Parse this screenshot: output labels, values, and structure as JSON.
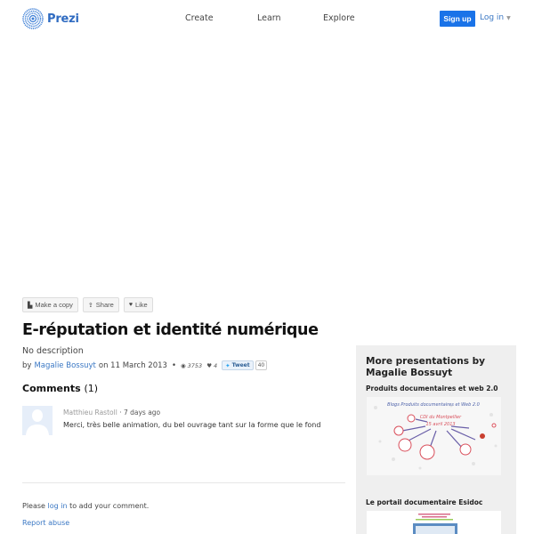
{
  "header": {
    "logo_text": "Prezi",
    "logo_icon": "prezi-logo-icon",
    "nav": [
      "Create",
      "Learn",
      "Explore"
    ],
    "signup_label": "Sign up",
    "login_label": "Log in",
    "brand_color": "#1a73e8"
  },
  "actions": {
    "make_copy": "Make a copy",
    "share": "Share",
    "like": "Like"
  },
  "presentation": {
    "title": "E-réputation et identité numérique",
    "description": "No description",
    "by_prefix": "by",
    "author": "Magalie Bossuyt",
    "date_text": "on 11 March 2013",
    "separator": "•",
    "views": "3753",
    "likes": "4",
    "tweet_label": "Tweet",
    "tweet_count": "40"
  },
  "comments": {
    "heading": "Comments",
    "count": "(1)",
    "items": [
      {
        "author": "Matthieu Rastoll",
        "time": "· 7 days ago",
        "text": "Merci, très belle animation, du bel ouvrage tant sur la forme que le fond"
      }
    ],
    "login_prefix": "Please",
    "login_link": "log in",
    "login_suffix": "to add your comment.",
    "report_abuse": "Report abuse"
  },
  "sidebar": {
    "title": "More presentations by Magalie Bossuyt",
    "items": [
      {
        "title": "Produits documentaires et web 2.0",
        "thumb_caption": "Blogs Produits documentaires et Web 2.0"
      },
      {
        "title": "Le portail documentaire Esidoc"
      }
    ]
  }
}
